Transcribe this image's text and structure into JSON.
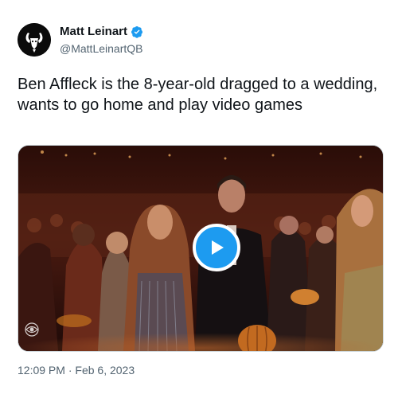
{
  "author": {
    "name": "Matt Leinart",
    "handle": "@MattLeinartQB",
    "avatar_icon": "goat-logo-icon",
    "verified_icon": "verified-badge-icon"
  },
  "tweet": {
    "text": "Ben Affleck is the 8-year-old dragged to a wedding, wants to go home and play video games"
  },
  "media": {
    "type": "video",
    "play_icon": "play-icon",
    "watermark_icon": "cbs-eye-icon"
  },
  "footer": {
    "time": "12:09 PM",
    "separator": "·",
    "date": "Feb 6, 2023"
  },
  "colors": {
    "accent": "#1d9bf0",
    "text": "#0f1419",
    "secondary": "#536471"
  }
}
